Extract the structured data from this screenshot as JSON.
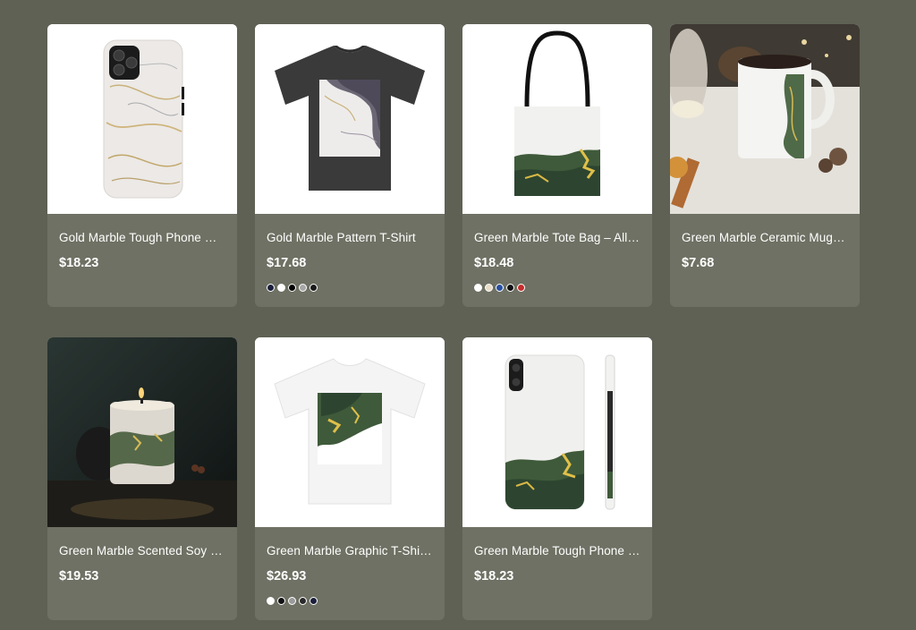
{
  "products": [
    {
      "title": "Gold Marble Tough Phone Ca...",
      "price": "$18.23",
      "swatches": []
    },
    {
      "title": "Gold Marble Pattern T-Shirt",
      "price": "$17.68",
      "swatches": [
        "#1b1f3b",
        "#ffffff",
        "#000000",
        "#a7a7a7",
        "#1a1a1a"
      ]
    },
    {
      "title": "Green Marble Tote Bag – All ...",
      "price": "$18.48",
      "swatches": [
        "#ffffff",
        "#e7dcc7",
        "#274ea0",
        "#111111",
        "#c62c2c"
      ]
    },
    {
      "title": "Green Marble Ceramic Mug - ...",
      "price": "$7.68",
      "swatches": []
    },
    {
      "title": "Green Marble Scented Soy C...",
      "price": "$19.53",
      "swatches": []
    },
    {
      "title": "Green Marble Graphic T-Shirt ...",
      "price": "$26.93",
      "swatches": [
        "#ffffff",
        "#111111",
        "#9a9a9a",
        "#2a2a2a",
        "#1b1f3b"
      ]
    },
    {
      "title": "Green Marble Tough Phone C...",
      "price": "$18.23",
      "swatches": []
    }
  ],
  "colors": {
    "page_background": "#5e6154",
    "card_background": "#6e7163",
    "text": "#ffffff"
  },
  "icons": [
    "phone-case-gold-marble-image",
    "tshirt-gold-marble-image",
    "tote-bag-green-marble-image",
    "mug-green-marble-image",
    "candle-green-marble-image",
    "tshirt-green-marble-image",
    "phone-case-green-marble-image"
  ]
}
